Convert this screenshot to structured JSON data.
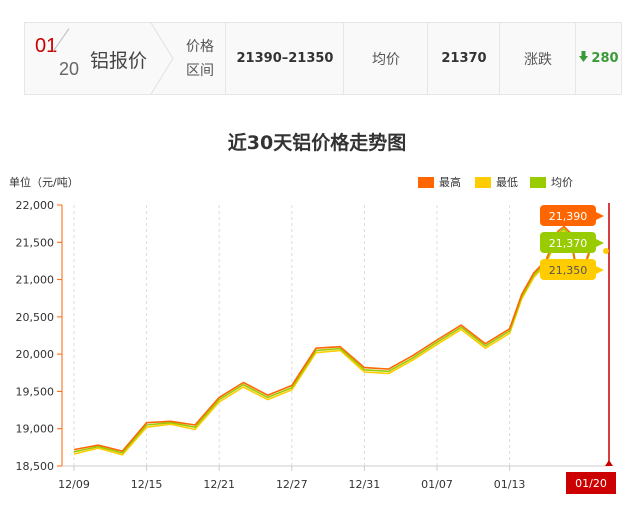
{
  "price_bar": {
    "month": "01",
    "day": "20",
    "metal": "铝报价",
    "range_label_line1": "价格",
    "range_label_line2": "区间",
    "range_value": "21390–21350",
    "avg_label": "均价",
    "avg_value": "21370",
    "change_label": "涨跌",
    "change_value": "280",
    "change_color": "#3a9a3a"
  },
  "chart_data": {
    "type": "line",
    "title": "近30天铝价格走势图",
    "ylabel": "单位（元/吨）",
    "ylim": [
      18500,
      22000
    ],
    "yticks": [
      "22,000",
      "21,500",
      "21,000",
      "20,500",
      "20,000",
      "19,500",
      "19,000",
      "18,500"
    ],
    "ytick_values": [
      22000,
      21500,
      21000,
      20500,
      20000,
      19500,
      19000,
      18500
    ],
    "xtick_labels": [
      "12/09",
      "12/15",
      "12/21",
      "12/27",
      "12/31",
      "01/07",
      "01/13"
    ],
    "xtick_indices": [
      0,
      6,
      12,
      18,
      24,
      30,
      36
    ],
    "grid": "vertical dashed at x ticks",
    "legend_position": "top-right",
    "series": [
      {
        "name": "最高",
        "color": "#ff6600",
        "values": [
          18720,
          18780,
          18700,
          19080,
          19100,
          19050,
          19420,
          19620,
          19450,
          19580,
          20080,
          20100,
          19820,
          19800,
          19980,
          20190,
          20390,
          20140,
          20340,
          20800,
          21090,
          21260,
          21650,
          21710,
          21630,
          21170,
          21100,
          21390
        ]
      },
      {
        "name": "最低",
        "color": "#ffcc00",
        "values": [
          18660,
          18740,
          18650,
          19020,
          19060,
          18990,
          19360,
          19560,
          19390,
          19520,
          20020,
          20050,
          19760,
          19740,
          19920,
          20130,
          20330,
          20080,
          20280,
          20740,
          21030,
          21200,
          21590,
          21650,
          21570,
          21110,
          21040,
          21350
        ]
      },
      {
        "name": "均价",
        "color": "#99cc00",
        "values": [
          18690,
          18760,
          18675,
          19050,
          19080,
          19020,
          19390,
          19590,
          19420,
          19550,
          20050,
          20075,
          19790,
          19770,
          19950,
          20160,
          20360,
          20110,
          20310,
          20770,
          21060,
          21230,
          21620,
          21680,
          21600,
          21140,
          21070,
          21370
        ]
      }
    ],
    "x_index_last": 40,
    "series_x_indices": [
      0,
      2,
      4,
      6,
      8,
      10,
      12,
      14,
      16,
      18,
      20,
      22,
      24,
      26,
      28,
      30,
      32,
      34,
      36,
      37,
      38,
      39,
      40,
      40.5,
      41,
      41.5,
      42,
      42.6
    ],
    "callouts": [
      {
        "label": "21,390",
        "color": "#ff6600"
      },
      {
        "label": "21,370",
        "color": "#99cc00"
      },
      {
        "label": "21,350",
        "color": "#ffcc00"
      }
    ],
    "marker_date": "01/20",
    "marker_color": "#cc0000"
  }
}
